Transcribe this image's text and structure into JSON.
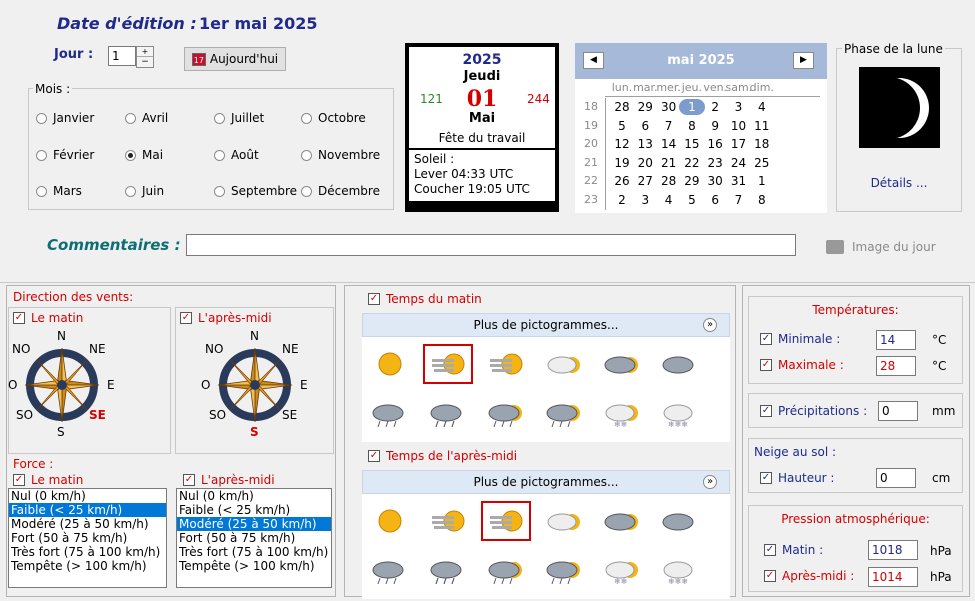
{
  "header": {
    "edition_label": "Date d'édition :",
    "edition_value": "1er mai 2025",
    "day_label": "Jour :",
    "day_value": "1",
    "today_button": "Aujourd'hui"
  },
  "months": {
    "group_label": "Mois :",
    "items": [
      "Janvier",
      "Avril",
      "Juillet",
      "Octobre",
      "Février",
      "Mai",
      "Août",
      "Novembre",
      "Mars",
      "Juin",
      "Septembre",
      "Décembre"
    ],
    "selected": "Mai"
  },
  "daycard": {
    "year": "2025",
    "weekday": "Jeudi",
    "day_of_year": "121",
    "day": "01",
    "days_left": "244",
    "month": "Mai",
    "holiday": "Fête du travail",
    "sun_label": "Soleil :",
    "sunrise": "Lever 04:33 UTC",
    "sunset": "Coucher 19:05 UTC"
  },
  "calendar": {
    "title": "mai 2025",
    "weekdays": [
      "lun.",
      "mar.",
      "mer.",
      "jeu.",
      "ven.",
      "sam.",
      "dim."
    ],
    "weeks": [
      "18",
      "19",
      "20",
      "21",
      "22",
      "23"
    ],
    "rows": [
      [
        "28",
        "29",
        "30",
        "1",
        "2",
        "3",
        "4"
      ],
      [
        "5",
        "6",
        "7",
        "8",
        "9",
        "10",
        "11"
      ],
      [
        "12",
        "13",
        "14",
        "15",
        "16",
        "17",
        "18"
      ],
      [
        "19",
        "20",
        "21",
        "22",
        "23",
        "24",
        "25"
      ],
      [
        "26",
        "27",
        "28",
        "29",
        "30",
        "31",
        "1"
      ],
      [
        "2",
        "3",
        "4",
        "5",
        "6",
        "7",
        "8"
      ]
    ]
  },
  "moon": {
    "label": "Phase de la lune",
    "details_button": "Détails ..."
  },
  "comment": {
    "label": "Commentaires :",
    "value": "",
    "image_button": "Image du jour"
  },
  "wind": {
    "label": "Direction des vents:",
    "morning": "Le matin",
    "afternoon": "L'après-midi",
    "n": "N",
    "ne": "NE",
    "e": "E",
    "se": "SE",
    "s": "S",
    "so": "SO",
    "o": "O",
    "no": "NO"
  },
  "force": {
    "label": "Force :",
    "morning": "Le matin",
    "afternoon": "L'après-midi",
    "items": [
      "Nul (0 km/h)",
      "Faible (< 25 km/h)",
      "Modéré (25 à 50 km/h)",
      "Fort (50 à 75 km/h)",
      "Très fort (75 à 100 km/h)",
      "Tempête (> 100 km/h)"
    ],
    "morning_selected": "Faible (< 25 km/h)",
    "afternoon_selected": "Modéré (25 à 50 km/h)"
  },
  "weather": {
    "morning_label": "Temps du matin",
    "afternoon_label": "Temps de l'après-midi",
    "more": "Plus de pictogrammes..."
  },
  "temps": {
    "label": "Températures:",
    "min_label": "Minimale :",
    "min_value": "14",
    "max_label": "Maximale :",
    "max_value": "28",
    "unit": "°C"
  },
  "precip": {
    "label": "Précipitations :",
    "value": "0",
    "unit": "mm"
  },
  "snow": {
    "label": "Neige au sol :",
    "height_label": "Hauteur :",
    "value": "0",
    "unit": "cm"
  },
  "pressure": {
    "label": "Pression atmosphérique:",
    "morning_label": "Matin :",
    "morning_value": "1018",
    "afternoon_label": "Après-midi :",
    "afternoon_value": "1014",
    "unit": "hPa"
  }
}
